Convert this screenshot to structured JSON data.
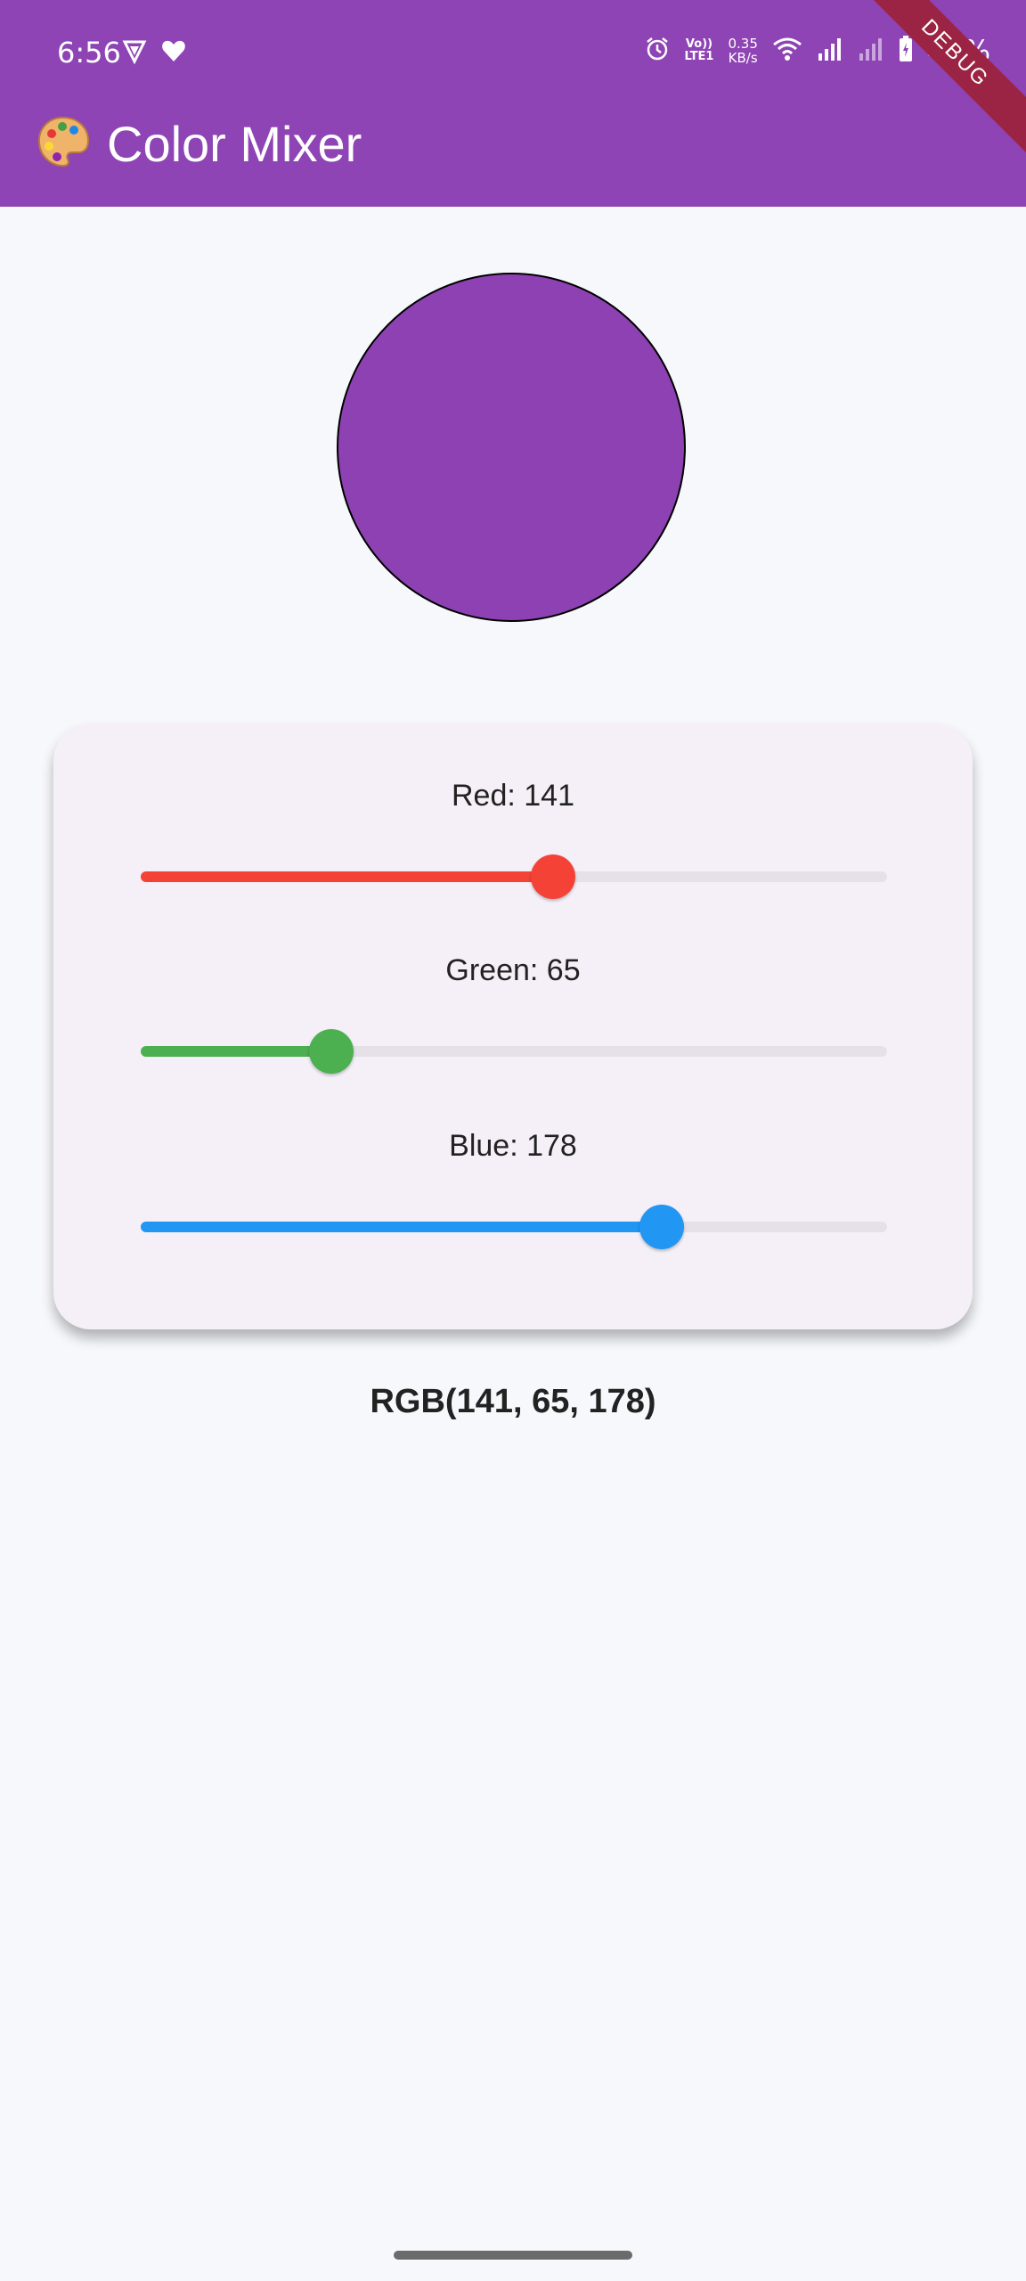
{
  "status_bar": {
    "time": "6:56",
    "battery": "48%",
    "net_speed_value": "0.35",
    "net_speed_unit": "KB/s",
    "volte_top": "Vo))",
    "volte_bottom": "LTE1"
  },
  "app_bar": {
    "title": "Color Mixer",
    "background": "#8e44b4",
    "debug_banner": "DEBUG"
  },
  "preview": {
    "color": "#8d41b2"
  },
  "sliders": [
    {
      "label": "Red: 141",
      "value": 141,
      "max": 255,
      "color": "#f44336"
    },
    {
      "label": "Green: 65",
      "value": 65,
      "max": 255,
      "color": "#4caf50"
    },
    {
      "label": "Blue: 178",
      "value": 178,
      "max": 255,
      "color": "#2196f3"
    }
  ],
  "rgb_readout": "RGB(141, 65, 178)"
}
